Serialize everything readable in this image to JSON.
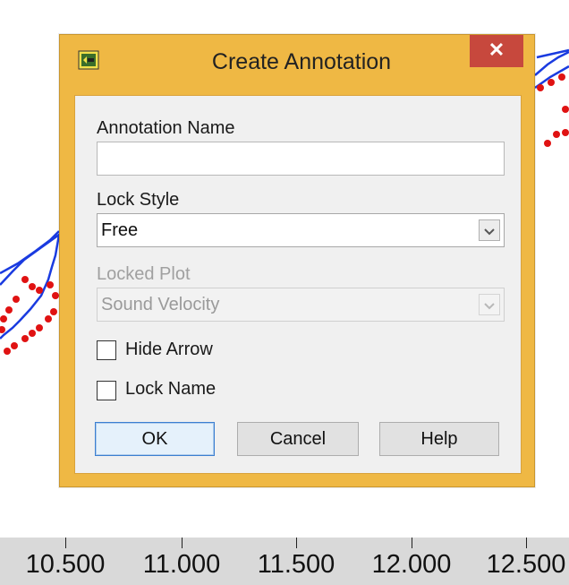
{
  "plot": {
    "x_ticks": [
      "10.500",
      "11.000",
      "11.500",
      "12.000",
      "12.500"
    ],
    "series_colors": {
      "line": "#1a3be0",
      "dots": "#e01212"
    }
  },
  "dialog": {
    "title": "Create Annotation",
    "close_symbol": "✕",
    "annotation_name_label": "Annotation Name",
    "annotation_name_value": "",
    "lock_style_label": "Lock Style",
    "lock_style_value": "Free",
    "locked_plot_label": "Locked Plot",
    "locked_plot_value": "Sound Velocity",
    "hide_arrow_label": "Hide Arrow",
    "lock_name_label": "Lock Name",
    "ok_label": "OK",
    "cancel_label": "Cancel",
    "help_label": "Help"
  }
}
